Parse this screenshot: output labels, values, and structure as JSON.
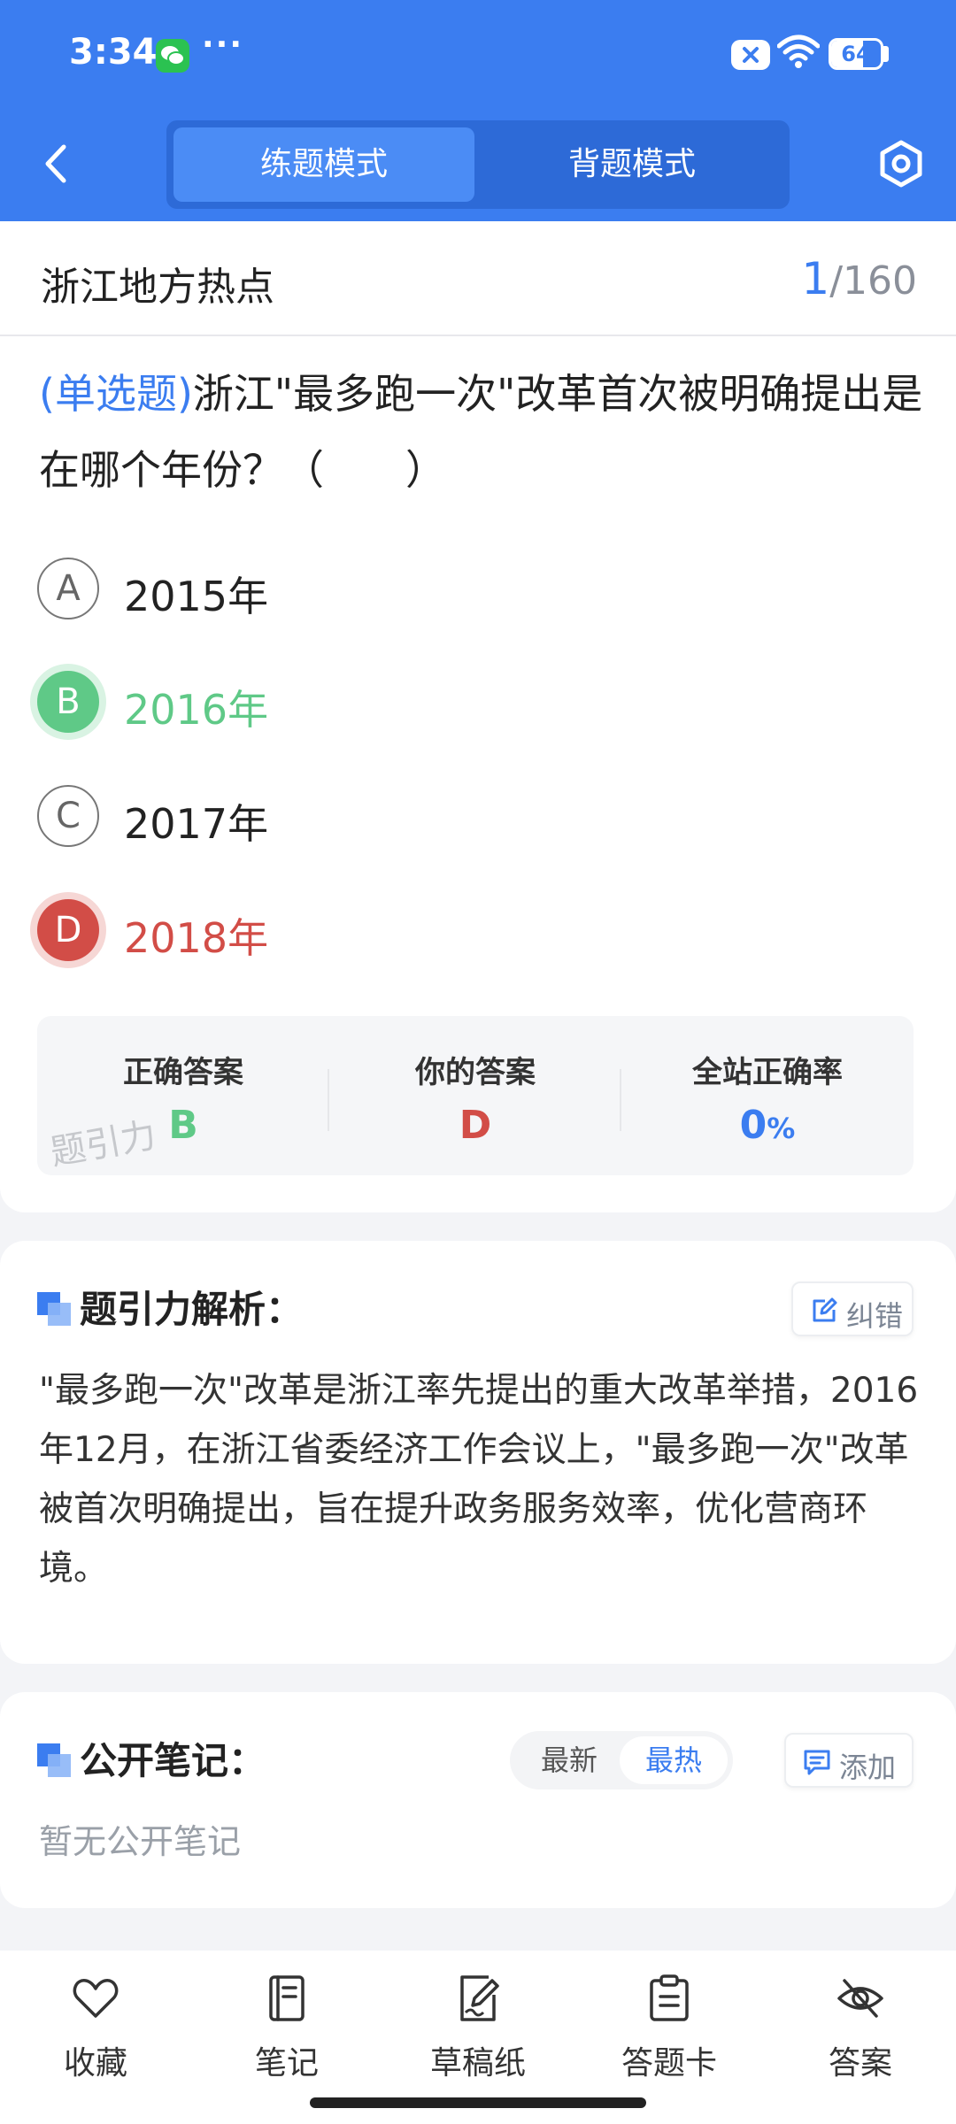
{
  "status_bar": {
    "time": "3:34",
    "more": "···",
    "battery_level": "64",
    "icons": [
      "wechat-icon",
      "close-badge-icon",
      "wifi-icon",
      "battery-icon"
    ]
  },
  "header": {
    "tabs": [
      {
        "label": "练题模式",
        "active": true
      },
      {
        "label": "背题模式",
        "active": false
      }
    ],
    "accent_color": "#3b7df0"
  },
  "title_row": {
    "chapter": "浙江地方热点",
    "current": "1",
    "total": "/160"
  },
  "question": {
    "type": "(单选题)",
    "text": "浙江\"最多跑一次\"改革首次被明确提出是在哪个年份？（　　）",
    "options": [
      {
        "letter": "A",
        "text": "2015年",
        "state": "normal"
      },
      {
        "letter": "B",
        "text": "2016年",
        "state": "correct"
      },
      {
        "letter": "C",
        "text": "2017年",
        "state": "normal"
      },
      {
        "letter": "D",
        "text": "2018年",
        "state": "wrong"
      }
    ]
  },
  "summary": {
    "correct_label": "正确答案",
    "correct_value": "B",
    "yours_label": "你的答案",
    "yours_value": "D",
    "rate_label": "全站正确率",
    "rate_value": "0",
    "rate_unit": "%",
    "watermark": "题引力",
    "correct_color": "#5fc987",
    "wrong_color": "#d24d47"
  },
  "analysis": {
    "title": "题引力解析：",
    "correction_label": "纠错",
    "text": "\"最多跑一次\"改革是浙江率先提出的重大改革举措，2016年12月，在浙江省委经济工作会议上，\"最多跑一次\"改革被首次明确提出，旨在提升政务服务效率，优化营商环境。"
  },
  "notes": {
    "title": "公开笔记：",
    "sort_options": [
      {
        "label": "最新",
        "active": false
      },
      {
        "label": "最热",
        "active": true
      }
    ],
    "add_label": "添加",
    "empty_text": "暂无公开笔记"
  },
  "bottom_nav": [
    {
      "label": "收藏",
      "icon": "heart-icon"
    },
    {
      "label": "笔记",
      "icon": "notebook-icon"
    },
    {
      "label": "草稿纸",
      "icon": "draft-icon"
    },
    {
      "label": "答题卡",
      "icon": "answer-sheet-icon"
    },
    {
      "label": "答案",
      "icon": "eye-off-icon"
    }
  ]
}
